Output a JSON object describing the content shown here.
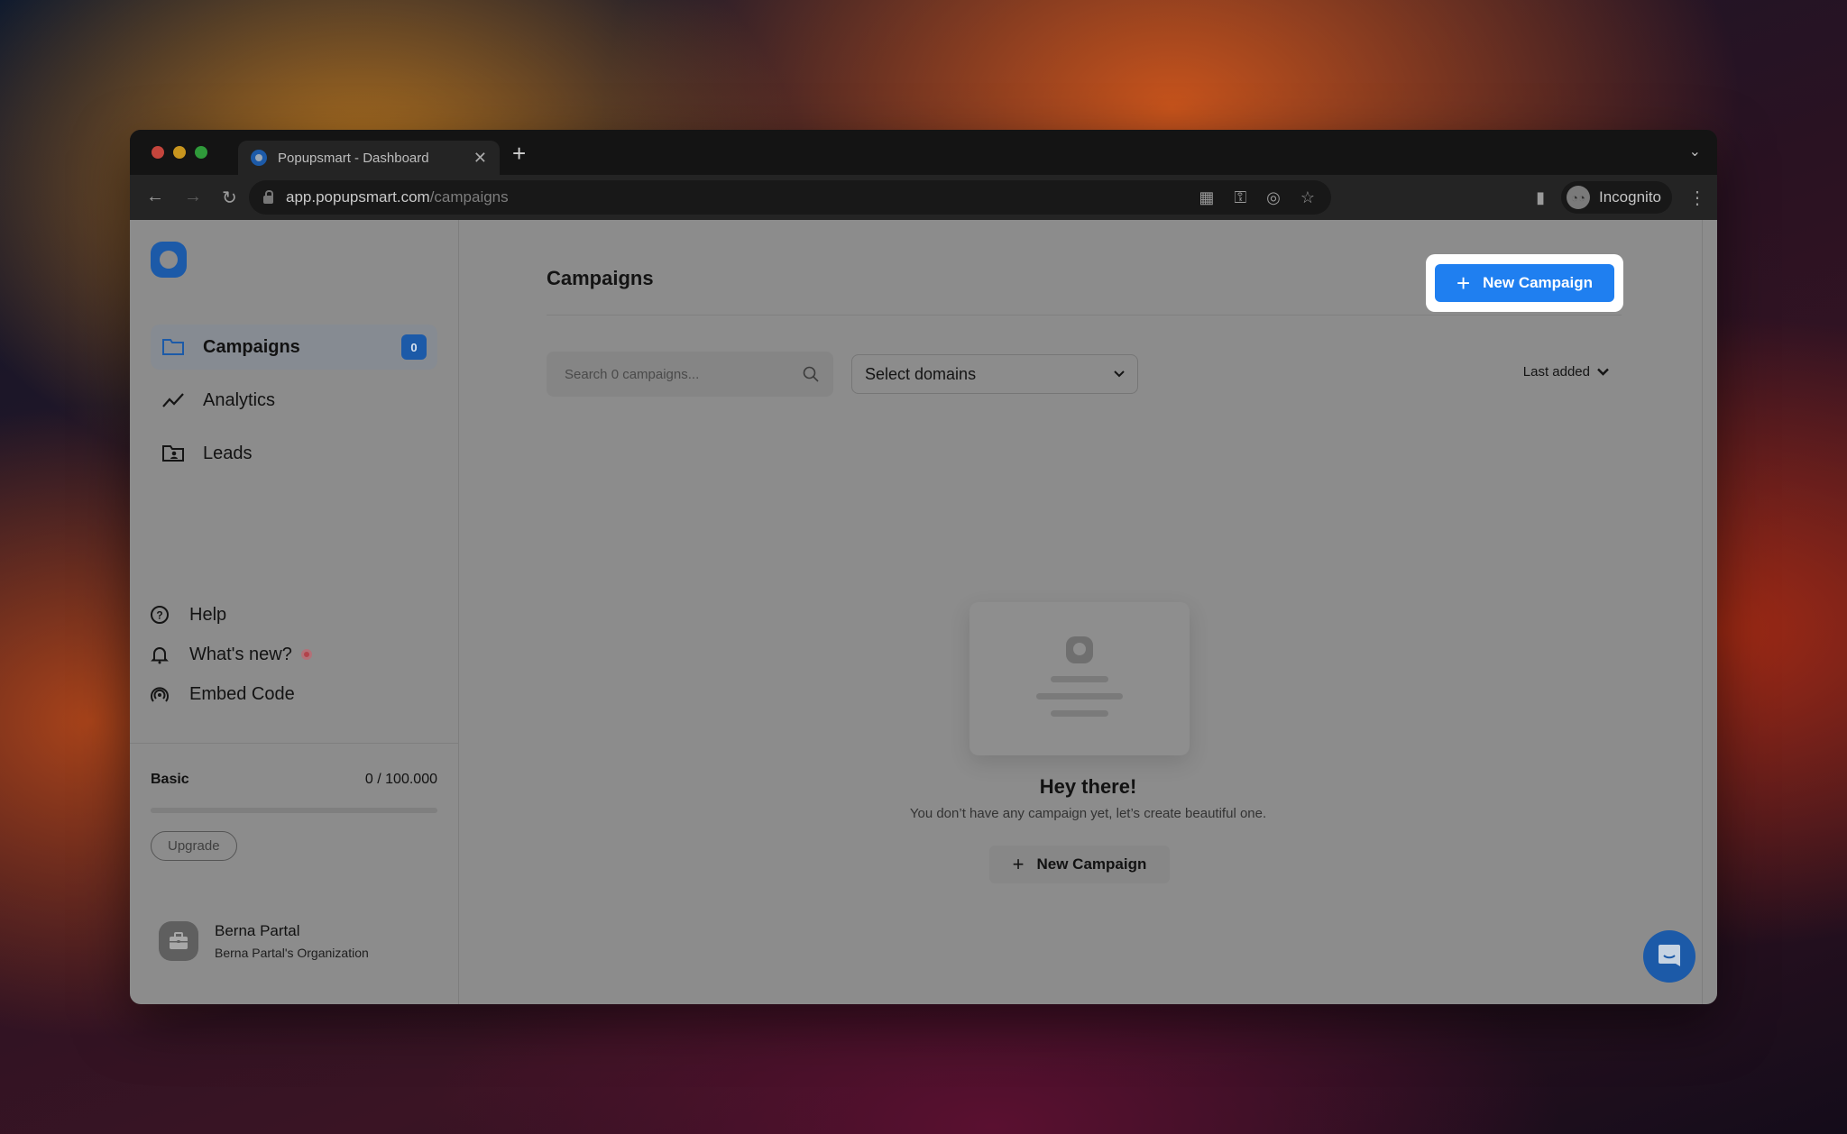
{
  "browser": {
    "tab_title": "Popupsmart - Dashboard",
    "url_host": "app.popupsmart.com",
    "url_path": "/campaigns",
    "profile_label": "Incognito",
    "traffic_colors": [
      "#c4453c",
      "#c8951e",
      "#2f9a3a"
    ]
  },
  "sidebar": {
    "items": [
      {
        "label": "Campaigns",
        "icon": "folder-icon",
        "badge": "0",
        "active": true
      },
      {
        "label": "Analytics",
        "icon": "trend-line-icon"
      },
      {
        "label": "Leads",
        "icon": "contact-folder-icon"
      }
    ],
    "bottom_items": [
      {
        "label": "Help",
        "icon": "help-circle-icon"
      },
      {
        "label": "What's new?",
        "icon": "bell-icon",
        "has_dot": true
      },
      {
        "label": "Embed Code",
        "icon": "broadcast-icon"
      }
    ],
    "plan": {
      "name": "Basic",
      "usage": "0 / 100.000",
      "usage_fraction": 0,
      "upgrade_label": "Upgrade"
    },
    "user": {
      "name": "Berna Partal",
      "organization": "Berna Partal's Organization"
    }
  },
  "main": {
    "title": "Campaigns",
    "new_campaign_label": "New Campaign",
    "search_placeholder": "Search 0 campaigns...",
    "domain_select": "Select domains",
    "sort_label": "Last added",
    "empty": {
      "title": "Hey there!",
      "subtitle": "You don’t have any campaign yet, let’s create beautiful one.",
      "button_label": "New Campaign"
    }
  },
  "colors": {
    "primary": "#1f7ff0",
    "brand": "#1c5aa8"
  }
}
